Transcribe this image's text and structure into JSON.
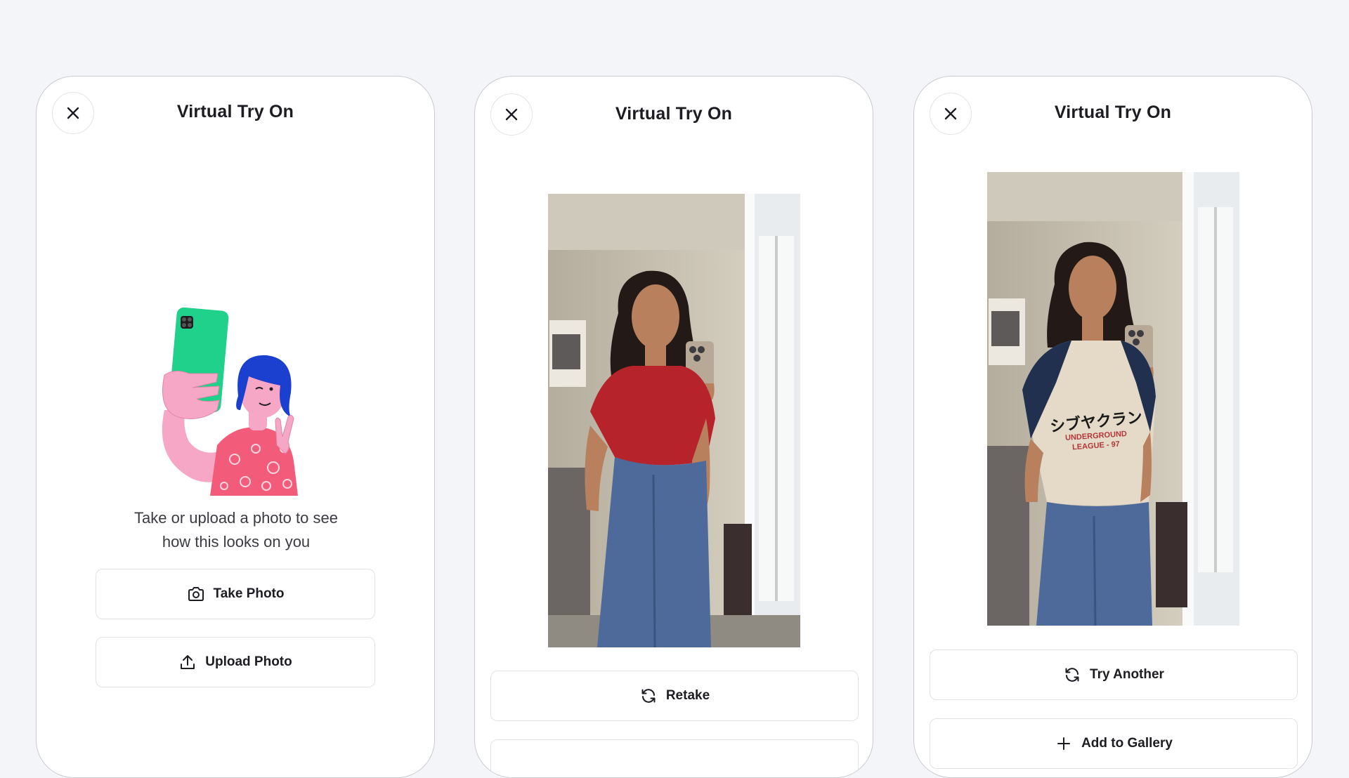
{
  "colors": {
    "background": "#f4f5f9",
    "card": "#ffffff",
    "card_border": "#c9cbd2",
    "text": "#1c1c22",
    "illustration_phone": "#1fd18a",
    "illustration_skin": "#f6a7c6",
    "illustration_hair": "#1b3fcf",
    "illustration_top": "#f25c7a"
  },
  "screens": [
    {
      "title": "Virtual Try On",
      "close_icon": "close-icon",
      "illustration": "selfie-illustration",
      "prompt_line1": "Take or upload a photo to see",
      "prompt_line2": "how this looks on you",
      "take_photo_label": "Take Photo",
      "take_photo_icon": "camera-icon",
      "upload_photo_label": "Upload Photo",
      "upload_photo_icon": "upload-icon"
    },
    {
      "title": "Virtual Try On",
      "close_icon": "close-icon",
      "photo": "mirror-selfie-red-top",
      "retake_label": "Retake",
      "retake_icon": "refresh-icon"
    },
    {
      "title": "Virtual Try On",
      "close_icon": "close-icon",
      "photo": "mirror-selfie-tryon-result",
      "shirt_print_jp": "シブヤクラン",
      "shirt_print_line1": "UNDERGROUND",
      "shirt_print_line2": "LEAGUE - 97",
      "try_another_label": "Try Another",
      "try_another_icon": "refresh-icon",
      "add_gallery_label": "Add to Gallery",
      "add_gallery_icon": "plus-icon"
    }
  ]
}
